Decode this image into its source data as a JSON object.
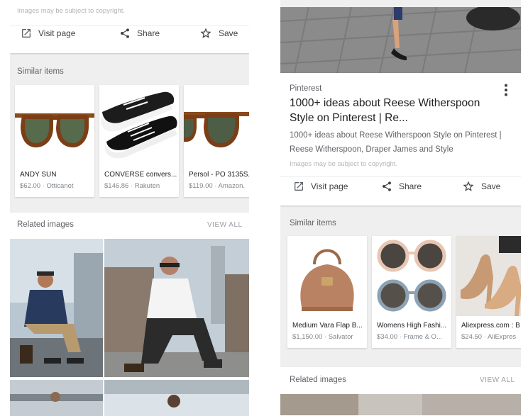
{
  "left": {
    "copyright": "Images may be subject to copyright.",
    "actions": {
      "visit": "Visit page",
      "share": "Share",
      "save": "Save"
    },
    "similar_label": "Similar items",
    "items": [
      {
        "name": "ANDY SUN",
        "price": "$62.00 · Otticanet",
        "icon": "tortoise-sunglasses-image"
      },
      {
        "name": "CONVERSE convers...",
        "price": "$146.86 · Rakuten",
        "icon": "black-sneakers-image"
      },
      {
        "name": "Persol - PO 3135S...",
        "price": "$119.00 · Amazon.",
        "icon": "tortoise-sunglasses-image"
      }
    ],
    "related_label": "Related images",
    "view_all": "VIEW ALL"
  },
  "right": {
    "source": "Pinterest",
    "title_line1": "1000+ ideas about Reese Witherspoon",
    "title_line2": "Style on Pinterest | Re...",
    "desc_line1": "1000+ ideas about Reese Witherspoon Style on Pinterest |",
    "desc_line2": "Reese Witherspoon, Draper James and Style",
    "copyright": "Images may be subject to copyright.",
    "actions": {
      "visit": "Visit page",
      "share": "Share",
      "save": "Save"
    },
    "similar_label": "Similar items",
    "items": [
      {
        "name": "Medium Vara Flap B...",
        "price": "$1,150.00 · Salvator",
        "icon": "tan-handbag-image"
      },
      {
        "name": "Womens High Fashi...",
        "price": "$34.00 · Frame & O...",
        "icon": "round-sunglasses-image"
      },
      {
        "name": "Aliexpress.com : B",
        "price": "$24.50 · AliExpres",
        "icon": "gold-heels-image"
      }
    ],
    "related_label": "Related images",
    "view_all": "VIEW ALL"
  },
  "colors": {
    "panel_bg": "#efefef",
    "card_bg": "#ffffff",
    "text_primary": "#202124",
    "text_secondary": "#5f6368",
    "text_muted": "#9aa0a6"
  }
}
